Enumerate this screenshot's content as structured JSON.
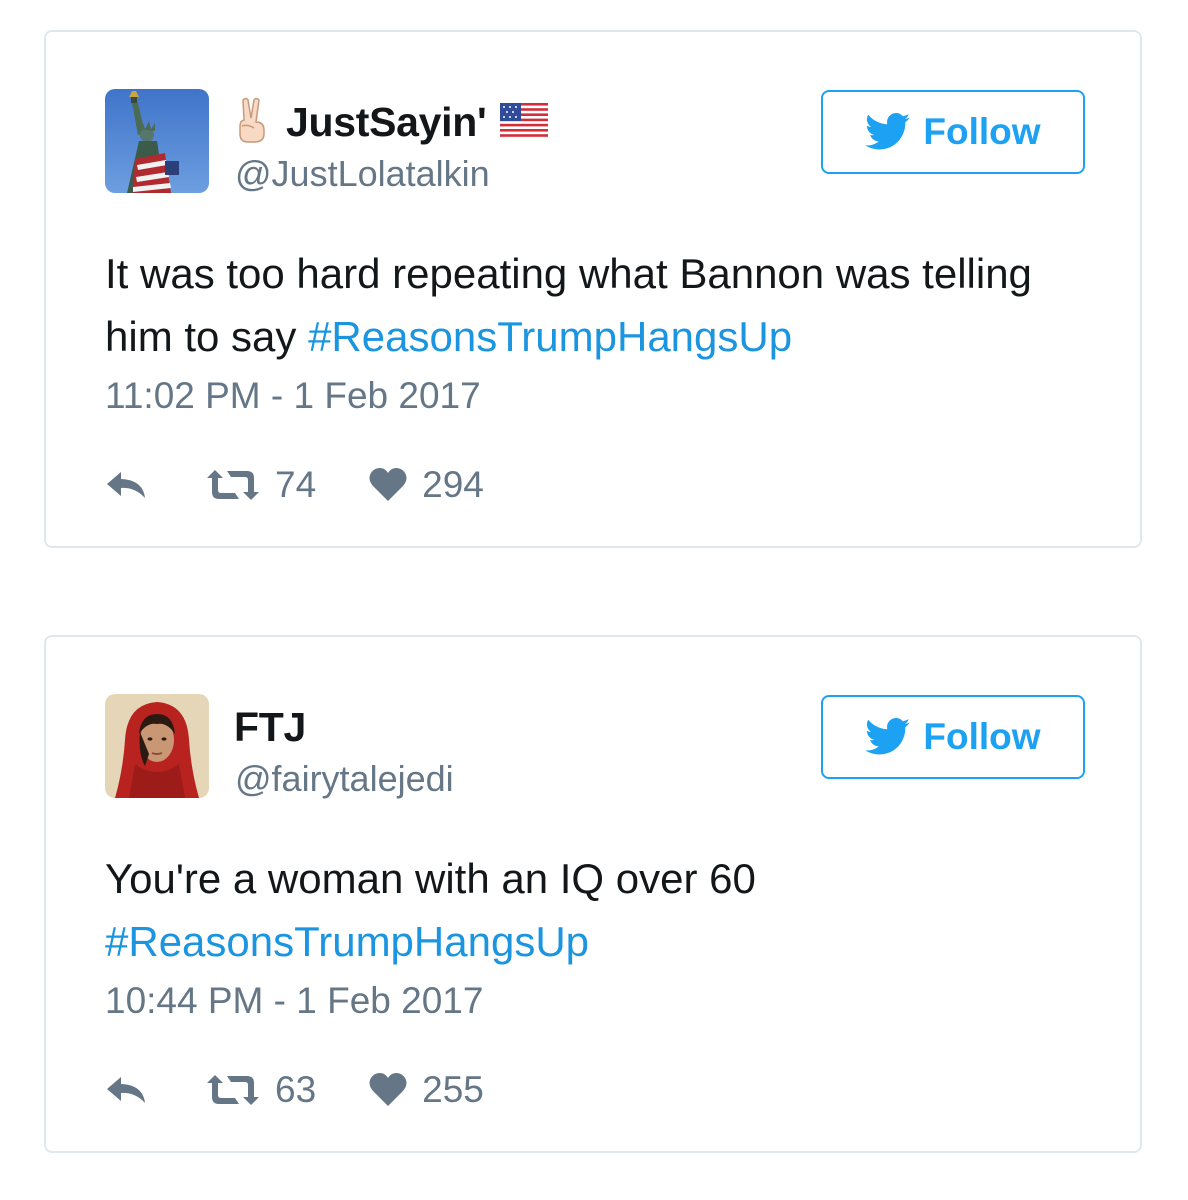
{
  "colors": {
    "twitter_blue": "#1da1f2",
    "hashtag": "#1b95e0",
    "text": "#14171a",
    "muted": "#657786",
    "border": "#e1e8ed"
  },
  "tweets": [
    {
      "display_name": "JustSayin'",
      "name_prefix_emoji": "✌🏻",
      "name_suffix_icon": "us-flag-icon",
      "handle": "@JustLolatalkin",
      "follow_label": "Follow",
      "text": "It was too hard repeating what Bannon was telling him to say ",
      "hashtag": "#ReasonsTrumpHangsUp",
      "timestamp": "11:02 PM - 1 Feb 2017",
      "retweets": "74",
      "likes": "294"
    },
    {
      "display_name": "FTJ",
      "handle": "@fairytalejedi",
      "follow_label": "Follow",
      "text": "You're a woman with an IQ over 60",
      "hashtag": "#ReasonsTrumpHangsUp",
      "timestamp": "10:44 PM - 1 Feb 2017",
      "retweets": "63",
      "likes": "255"
    }
  ]
}
